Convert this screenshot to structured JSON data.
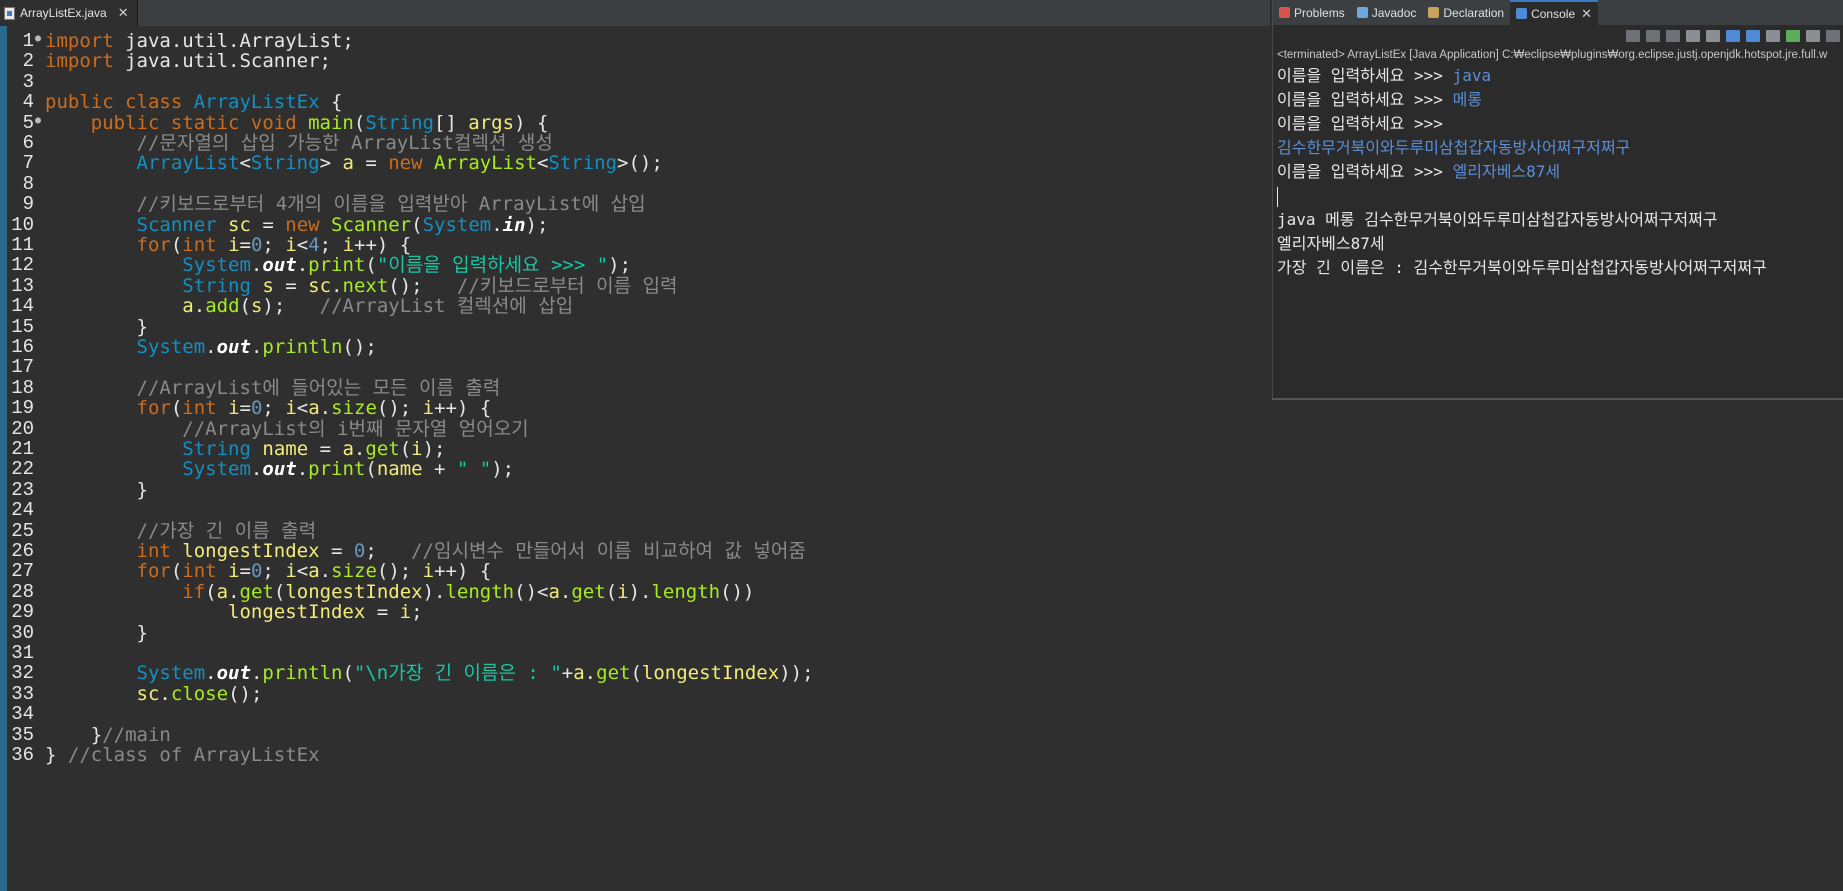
{
  "editor": {
    "tab_label": "ArrayListEx.java",
    "lines": [
      {
        "n": "1",
        "fold": true,
        "t": [
          [
            "kw",
            "import"
          ],
          [
            "par",
            " java.util.ArrayList;"
          ]
        ]
      },
      {
        "n": "2",
        "t": [
          [
            "kw",
            "import"
          ],
          [
            "par",
            " java.util.Scanner;"
          ]
        ]
      },
      {
        "n": "3",
        "t": []
      },
      {
        "n": "4",
        "t": [
          [
            "kw",
            "public class "
          ],
          [
            "ty",
            "ArrayListEx"
          ],
          [
            "par",
            " {"
          ]
        ]
      },
      {
        "n": "5",
        "fold": true,
        "t": [
          [
            "par",
            "    "
          ],
          [
            "kw",
            "public static void "
          ],
          [
            "fn",
            "main"
          ],
          [
            "par",
            "("
          ],
          [
            "ty",
            "String"
          ],
          [
            "par",
            "[] "
          ],
          [
            "va",
            "args"
          ],
          [
            "par",
            ") {"
          ]
        ]
      },
      {
        "n": "6",
        "t": [
          [
            "par",
            "        "
          ],
          [
            "cm",
            "//문자열의 삽입 가능한 ArrayList컬렉션 생성"
          ]
        ]
      },
      {
        "n": "7",
        "t": [
          [
            "par",
            "        "
          ],
          [
            "ty",
            "ArrayList"
          ],
          [
            "par",
            "<"
          ],
          [
            "ty",
            "String"
          ],
          [
            "par",
            "> "
          ],
          [
            "lc",
            "a"
          ],
          [
            "par",
            " = "
          ],
          [
            "kw",
            "new "
          ],
          [
            "fn",
            "ArrayList"
          ],
          [
            "par",
            "<"
          ],
          [
            "ty",
            "String"
          ],
          [
            "par",
            ">();"
          ]
        ]
      },
      {
        "n": "8",
        "t": []
      },
      {
        "n": "9",
        "t": [
          [
            "par",
            "        "
          ],
          [
            "cm",
            "//키보드로부터 4개의 이름을 입력받아 ArrayList에 삽입"
          ]
        ]
      },
      {
        "n": "10",
        "t": [
          [
            "par",
            "        "
          ],
          [
            "ty",
            "Scanner"
          ],
          [
            "par",
            " "
          ],
          [
            "lc",
            "sc"
          ],
          [
            "par",
            " = "
          ],
          [
            "kw",
            "new "
          ],
          [
            "fn",
            "Scanner"
          ],
          [
            "par",
            "("
          ],
          [
            "ty",
            "System"
          ],
          [
            "par",
            "."
          ],
          [
            "fld",
            "in"
          ],
          [
            "par",
            ");"
          ]
        ]
      },
      {
        "n": "11",
        "t": [
          [
            "par",
            "        "
          ],
          [
            "kw",
            "for"
          ],
          [
            "par",
            "("
          ],
          [
            "kw",
            "int "
          ],
          [
            "lc",
            "i"
          ],
          [
            "par",
            "="
          ],
          [
            "nm",
            "0"
          ],
          [
            "par",
            "; "
          ],
          [
            "lc",
            "i"
          ],
          [
            "par",
            "<"
          ],
          [
            "nm",
            "4"
          ],
          [
            "par",
            "; "
          ],
          [
            "lc",
            "i"
          ],
          [
            "par",
            "++) {"
          ]
        ]
      },
      {
        "n": "12",
        "t": [
          [
            "par",
            "            "
          ],
          [
            "ty",
            "System"
          ],
          [
            "par",
            "."
          ],
          [
            "fld",
            "out"
          ],
          [
            "par",
            "."
          ],
          [
            "fn",
            "print"
          ],
          [
            "par",
            "("
          ],
          [
            "st",
            "\"이름을 입력하세요 >>> \""
          ],
          [
            "par",
            ");"
          ]
        ]
      },
      {
        "n": "13",
        "t": [
          [
            "par",
            "            "
          ],
          [
            "ty",
            "String"
          ],
          [
            "par",
            " "
          ],
          [
            "lc",
            "s"
          ],
          [
            "par",
            " = "
          ],
          [
            "lc",
            "sc"
          ],
          [
            "par",
            "."
          ],
          [
            "fn",
            "next"
          ],
          [
            "par",
            "();   "
          ],
          [
            "cm",
            "//키보드로부터 이름 입력"
          ]
        ]
      },
      {
        "n": "14",
        "t": [
          [
            "par",
            "            "
          ],
          [
            "lc",
            "a"
          ],
          [
            "par",
            "."
          ],
          [
            "fn",
            "add"
          ],
          [
            "par",
            "("
          ],
          [
            "lc",
            "s"
          ],
          [
            "par",
            ");   "
          ],
          [
            "cm",
            "//ArrayList 컬렉션에 삽입"
          ]
        ]
      },
      {
        "n": "15",
        "t": [
          [
            "par",
            "        }"
          ]
        ]
      },
      {
        "n": "16",
        "t": [
          [
            "par",
            "        "
          ],
          [
            "ty",
            "System"
          ],
          [
            "par",
            "."
          ],
          [
            "fld",
            "out"
          ],
          [
            "par",
            "."
          ],
          [
            "fn",
            "println"
          ],
          [
            "par",
            "();"
          ]
        ]
      },
      {
        "n": "17",
        "t": []
      },
      {
        "n": "18",
        "t": [
          [
            "par",
            "        "
          ],
          [
            "cm",
            "//ArrayList에 들어있는 모든 이름 출력"
          ]
        ]
      },
      {
        "n": "19",
        "t": [
          [
            "par",
            "        "
          ],
          [
            "kw",
            "for"
          ],
          [
            "par",
            "("
          ],
          [
            "kw",
            "int "
          ],
          [
            "lc",
            "i"
          ],
          [
            "par",
            "="
          ],
          [
            "nm",
            "0"
          ],
          [
            "par",
            "; "
          ],
          [
            "lc",
            "i"
          ],
          [
            "par",
            "<"
          ],
          [
            "lc",
            "a"
          ],
          [
            "par",
            "."
          ],
          [
            "fn",
            "size"
          ],
          [
            "par",
            "(); "
          ],
          [
            "lc",
            "i"
          ],
          [
            "par",
            "++) {"
          ]
        ]
      },
      {
        "n": "20",
        "t": [
          [
            "par",
            "            "
          ],
          [
            "cm",
            "//ArrayList의 i번째 문자열 얻어오기"
          ]
        ]
      },
      {
        "n": "21",
        "t": [
          [
            "par",
            "            "
          ],
          [
            "ty",
            "String"
          ],
          [
            "par",
            " "
          ],
          [
            "lc",
            "name"
          ],
          [
            "par",
            " = "
          ],
          [
            "lc",
            "a"
          ],
          [
            "par",
            "."
          ],
          [
            "fn",
            "get"
          ],
          [
            "par",
            "("
          ],
          [
            "lc",
            "i"
          ],
          [
            "par",
            ");"
          ]
        ]
      },
      {
        "n": "22",
        "t": [
          [
            "par",
            "            "
          ],
          [
            "ty",
            "System"
          ],
          [
            "par",
            "."
          ],
          [
            "fld",
            "out"
          ],
          [
            "par",
            "."
          ],
          [
            "fn",
            "print"
          ],
          [
            "par",
            "("
          ],
          [
            "lc",
            "name"
          ],
          [
            "par",
            " + "
          ],
          [
            "st",
            "\" \""
          ],
          [
            "par",
            ");"
          ]
        ]
      },
      {
        "n": "23",
        "t": [
          [
            "par",
            "        }"
          ]
        ]
      },
      {
        "n": "24",
        "t": []
      },
      {
        "n": "25",
        "t": [
          [
            "par",
            "        "
          ],
          [
            "cm",
            "//가장 긴 이름 출력"
          ]
        ]
      },
      {
        "n": "26",
        "t": [
          [
            "par",
            "        "
          ],
          [
            "kw",
            "int "
          ],
          [
            "lc",
            "longestIndex"
          ],
          [
            "par",
            " = "
          ],
          [
            "nm",
            "0"
          ],
          [
            "par",
            ";   "
          ],
          [
            "cm",
            "//임시변수 만들어서 이름 비교하여 값 넣어줌"
          ]
        ]
      },
      {
        "n": "27",
        "t": [
          [
            "par",
            "        "
          ],
          [
            "kw",
            "for"
          ],
          [
            "par",
            "("
          ],
          [
            "kw",
            "int "
          ],
          [
            "lc",
            "i"
          ],
          [
            "par",
            "="
          ],
          [
            "nm",
            "0"
          ],
          [
            "par",
            "; "
          ],
          [
            "lc",
            "i"
          ],
          [
            "par",
            "<"
          ],
          [
            "lc",
            "a"
          ],
          [
            "par",
            "."
          ],
          [
            "fn",
            "size"
          ],
          [
            "par",
            "(); "
          ],
          [
            "lc",
            "i"
          ],
          [
            "par",
            "++) {"
          ]
        ]
      },
      {
        "n": "28",
        "t": [
          [
            "par",
            "            "
          ],
          [
            "kw",
            "if"
          ],
          [
            "par",
            "("
          ],
          [
            "lc",
            "a"
          ],
          [
            "par",
            "."
          ],
          [
            "fn",
            "get"
          ],
          [
            "par",
            "("
          ],
          [
            "lc",
            "longestIndex"
          ],
          [
            "par",
            ")."
          ],
          [
            "fn",
            "length"
          ],
          [
            "par",
            "()<"
          ],
          [
            "lc",
            "a"
          ],
          [
            "par",
            "."
          ],
          [
            "fn",
            "get"
          ],
          [
            "par",
            "("
          ],
          [
            "lc",
            "i"
          ],
          [
            "par",
            ")."
          ],
          [
            "fn",
            "length"
          ],
          [
            "par",
            "())"
          ]
        ]
      },
      {
        "n": "29",
        "t": [
          [
            "par",
            "                "
          ],
          [
            "lc",
            "longestIndex"
          ],
          [
            "par",
            " = "
          ],
          [
            "lc",
            "i"
          ],
          [
            "par",
            ";"
          ]
        ]
      },
      {
        "n": "30",
        "t": [
          [
            "par",
            "        }"
          ]
        ]
      },
      {
        "n": "31",
        "t": []
      },
      {
        "n": "32",
        "t": [
          [
            "par",
            "        "
          ],
          [
            "ty",
            "System"
          ],
          [
            "par",
            "."
          ],
          [
            "fld",
            "out"
          ],
          [
            "par",
            "."
          ],
          [
            "fn",
            "println"
          ],
          [
            "par",
            "("
          ],
          [
            "st",
            "\"\\n가장 긴 이름은 : \""
          ],
          [
            "par",
            "+"
          ],
          [
            "lc",
            "a"
          ],
          [
            "par",
            "."
          ],
          [
            "fn",
            "get"
          ],
          [
            "par",
            "("
          ],
          [
            "lc",
            "longestIndex"
          ],
          [
            "par",
            "));"
          ]
        ]
      },
      {
        "n": "33",
        "t": [
          [
            "par",
            "        "
          ],
          [
            "lc",
            "sc"
          ],
          [
            "par",
            "."
          ],
          [
            "fn",
            "close"
          ],
          [
            "par",
            "();"
          ]
        ]
      },
      {
        "n": "34",
        "t": []
      },
      {
        "n": "35",
        "t": [
          [
            "par",
            "    }"
          ],
          [
            "cm",
            "//main"
          ]
        ]
      },
      {
        "n": "36",
        "t": [
          [
            "par",
            "} "
          ],
          [
            "cm",
            "//class of ArrayListEx"
          ]
        ]
      }
    ]
  },
  "panel": {
    "tabs": [
      {
        "label": "Problems",
        "icon": "problems-icon",
        "color": "#d9534f",
        "active": false
      },
      {
        "label": "Javadoc",
        "icon": "javadoc-icon",
        "color": "#6fa8dc",
        "active": false
      },
      {
        "label": "Declaration",
        "icon": "declaration-icon",
        "color": "#c9a25b",
        "active": false
      },
      {
        "label": "Console",
        "icon": "console-icon",
        "color": "#4f8ad6",
        "active": true
      }
    ],
    "status": "<terminated> ArrayListEx [Java Application] C:₩eclipse₩plugins₩org.eclipse.justj.openjdk.hotspot.jre.full.w",
    "console": [
      [
        [
          "out",
          "이름을 입력하세요 >>> "
        ],
        [
          "in",
          "java"
        ]
      ],
      [
        [
          "out",
          "이름을 입력하세요 >>> "
        ],
        [
          "in",
          "메롱"
        ]
      ],
      [
        [
          "out",
          "이름을 입력하세요 >>> "
        ]
      ],
      [
        [
          "in",
          "김수한무거북이와두루미삼첩갑자동방사어쩌구저쩌구"
        ]
      ],
      [
        [
          "out",
          "이름을 입력하세요 >>> "
        ],
        [
          "in",
          "엘리자베스87세"
        ]
      ],
      [
        [
          "caret",
          ""
        ]
      ],
      [
        [
          "out",
          "java 메롱 김수한무거북이와두루미삼첩갑자동방사어쩌구저쩌구"
        ]
      ],
      [
        [
          "out",
          "엘리자베스87세"
        ]
      ],
      [
        [
          "out",
          "가장 긴 이름은 : 김수한무거북이와두루미삼첩갑자동방사어쩌구저쩌구"
        ]
      ]
    ]
  },
  "colors": {
    "keyword": "#cc6c1d",
    "type": "#1290c3",
    "method": "#a7ec21",
    "number": "#6897bb",
    "string": "#17c6a3",
    "comment": "#8a8a8a",
    "variable": "#f3ec79",
    "console_input": "#5a8fd8"
  }
}
